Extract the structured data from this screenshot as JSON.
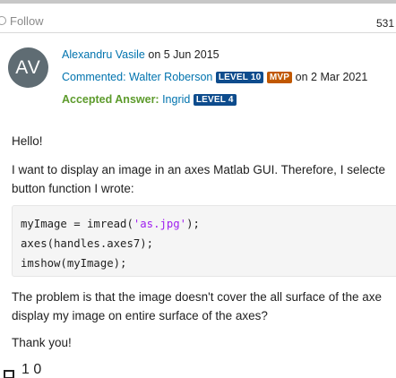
{
  "follow": {
    "label": "Follow",
    "count": "531"
  },
  "author": {
    "initials": "AV",
    "name": "Alexandru Vasile",
    "date_text": "on 5 Jun 2015"
  },
  "comment": {
    "prefix": "Commented:",
    "commenter": "Walter Roberson",
    "level_badge": "LEVEL 10",
    "mvp_badge": "MVP",
    "date_text": "on 2 Mar 2021"
  },
  "accepted": {
    "prefix": "Accepted Answer:",
    "name": "Ingrid",
    "level_badge": "LEVEL 4"
  },
  "question": {
    "greeting": "Hello!",
    "para1_line1": "I want to display an image in an axes Matlab GUI. Therefore, I selecte",
    "para1_line2": "button function I wrote:",
    "code": {
      "line1_pre": "myImage = imread(",
      "line1_str": "'as.jpg'",
      "line1_post": ");",
      "line2": "axes(handles.axes7);",
      "line3": "imshow(myImage);"
    },
    "para2_line1": "The problem is that the image doesn't cover the all surface of the axe",
    "para2_line2": "display my image on entire surface of the axes?",
    "thanks": "Thank you!"
  },
  "votes": {
    "count": "1 0"
  },
  "colors": {
    "link": "#0073ae",
    "accepted": "#5d9b2c",
    "level_badge": "#0e4c8d",
    "mvp_badge": "#c15800",
    "avatar": "#5f6c73"
  }
}
